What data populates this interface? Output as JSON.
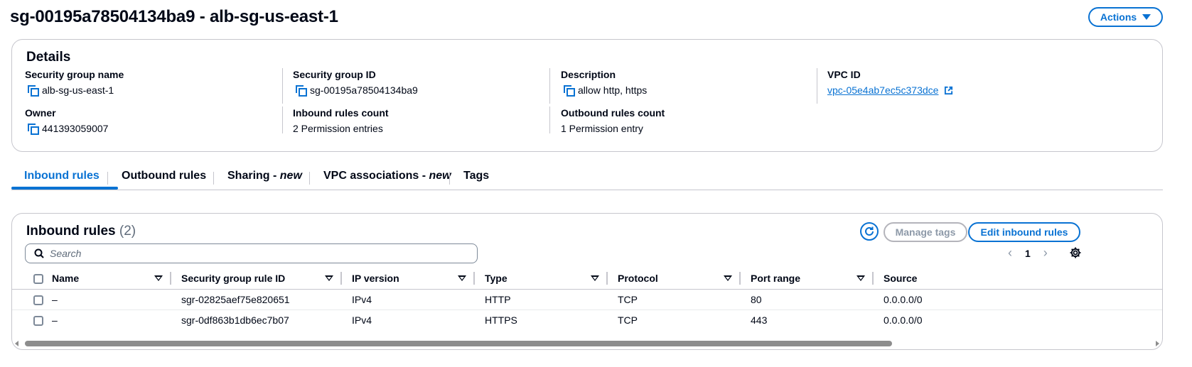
{
  "header": {
    "title": "sg-00195a78504134ba9 - alb-sg-us-east-1",
    "actions_label": "Actions"
  },
  "details": {
    "title": "Details",
    "fields": {
      "sg_name": {
        "label": "Security group name",
        "value": "alb-sg-us-east-1"
      },
      "sg_id": {
        "label": "Security group ID",
        "value": "sg-00195a78504134ba9"
      },
      "description": {
        "label": "Description",
        "value": "allow http, https"
      },
      "vpc_id": {
        "label": "VPC ID",
        "value": "vpc-05e4ab7ec5c373dce"
      },
      "owner": {
        "label": "Owner",
        "value": "441393059007"
      },
      "inbound_count": {
        "label": "Inbound rules count",
        "value": "2 Permission entries"
      },
      "outbound_count": {
        "label": "Outbound rules count",
        "value": "1 Permission entry"
      }
    }
  },
  "tabs": [
    {
      "label": "Inbound rules",
      "suffix": ""
    },
    {
      "label": "Outbound rules",
      "suffix": ""
    },
    {
      "label": "Sharing - ",
      "suffix": "new"
    },
    {
      "label": "VPC associations - ",
      "suffix": "new"
    },
    {
      "label": "Tags",
      "suffix": ""
    }
  ],
  "rules": {
    "title": "Inbound rules",
    "count": "(2)",
    "manage_tags_label": "Manage tags",
    "edit_label": "Edit inbound rules",
    "search_placeholder": "Search",
    "page": "1",
    "columns": [
      "Name",
      "Security group rule ID",
      "IP version",
      "Type",
      "Protocol",
      "Port range",
      "Source"
    ],
    "rows": [
      {
        "name": "–",
        "rule_id": "sgr-02825aef75e820651",
        "ip_version": "IPv4",
        "type": "HTTP",
        "protocol": "TCP",
        "port_range": "80",
        "source": "0.0.0.0/0"
      },
      {
        "name": "–",
        "rule_id": "sgr-0df863b1db6ec7b07",
        "ip_version": "IPv4",
        "type": "HTTPS",
        "protocol": "TCP",
        "port_range": "443",
        "source": "0.0.0.0/0"
      }
    ]
  },
  "colors": {
    "accent": "#0972d3",
    "text": "#000716",
    "border": "#c6c6cd",
    "disabled": "#8d99a8"
  }
}
